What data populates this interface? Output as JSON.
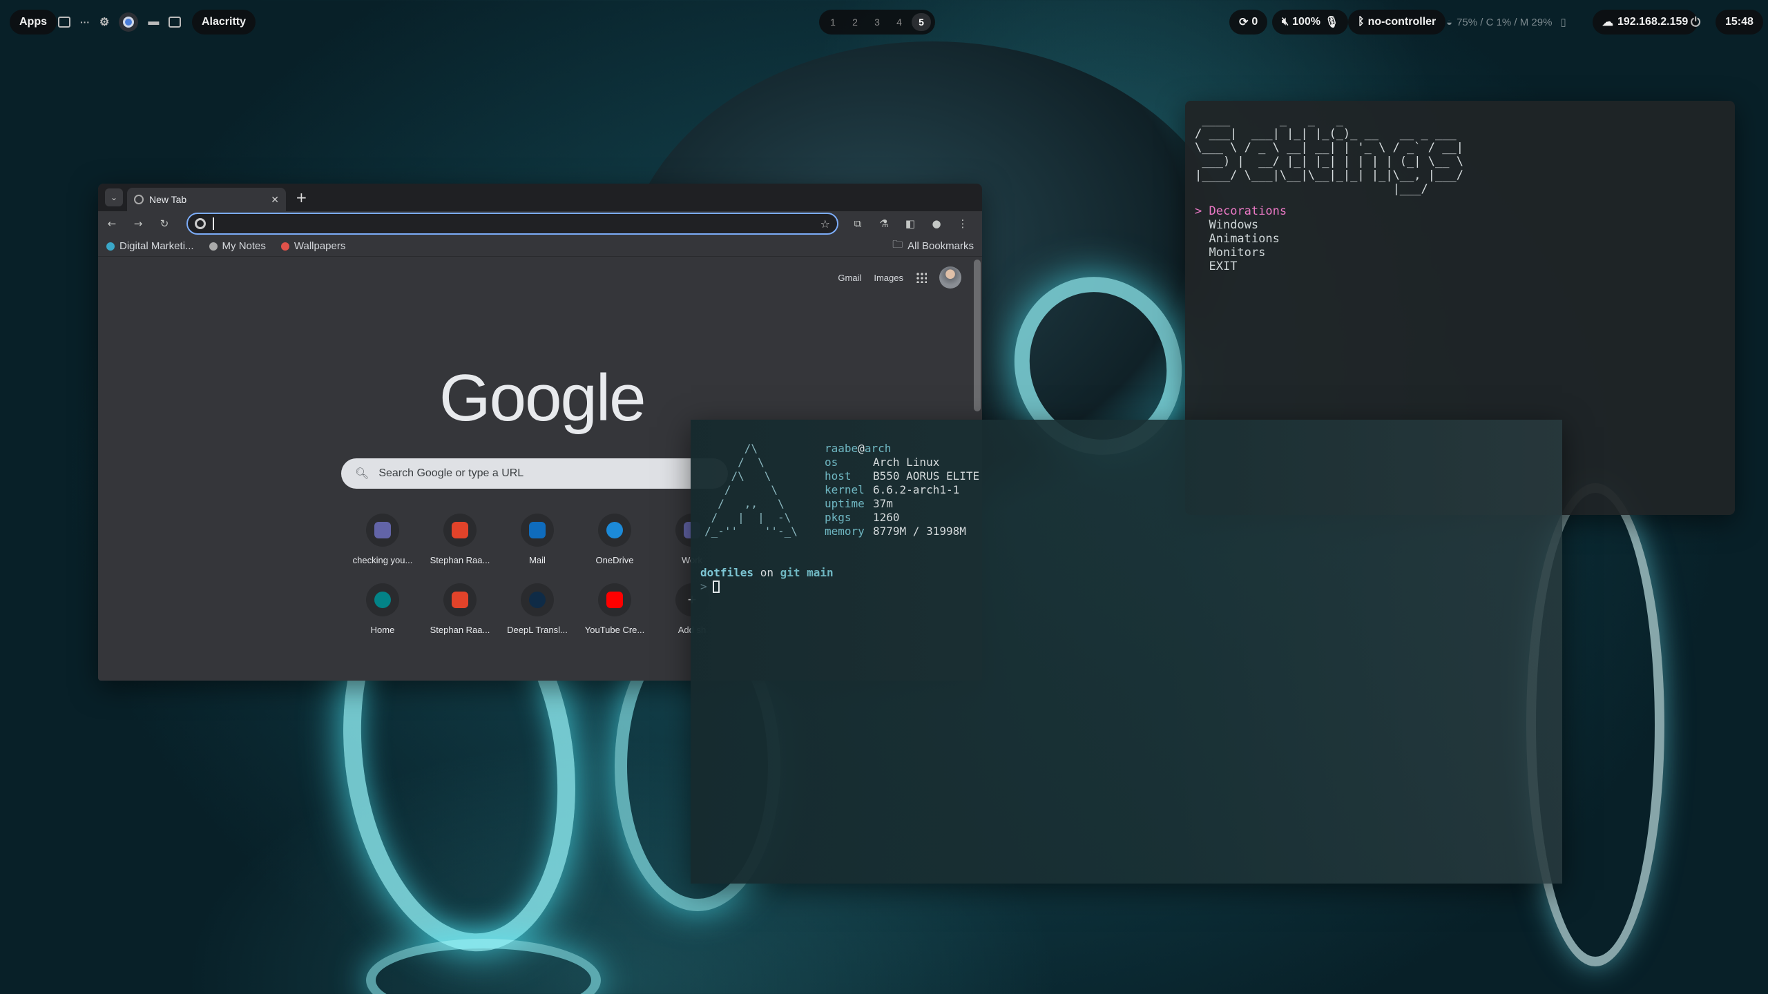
{
  "topbar": {
    "apps_label": "Apps",
    "active_app": "Alacritty",
    "workspaces": [
      "1",
      "2",
      "3",
      "4",
      "5"
    ],
    "active_workspace": "5",
    "updates": "0",
    "volume": "100%",
    "bluetooth": "no-controller",
    "stats": "75% / C 1% / M 29%",
    "ip": "192.168.2.159",
    "clock": "15:48"
  },
  "chrome": {
    "tab_title": "New Tab",
    "omnibox_value": "",
    "bookmarks": [
      "Digital Marketi...",
      "My Notes",
      "Wallpapers"
    ],
    "all_bookmarks": "All Bookmarks",
    "ntp_links": [
      "Gmail",
      "Images"
    ],
    "google_logo": "Google",
    "search_placeholder": "Search Google or type a URL",
    "shortcuts_row1": [
      "checking you...",
      "Stephan Raa...",
      "Mail",
      "OneDrive",
      "Work"
    ],
    "shortcuts_row2": [
      "Home",
      "Stephan Raa...",
      "DeepL Transl...",
      "YouTube Cre...",
      "Add sh"
    ],
    "icon_colors": {
      "teams": "#6264a7",
      "gitlab": "#e2432a",
      "outlook": "#0f6cbd",
      "onedrive": "#1c8ad8",
      "sharepoint": "#038387",
      "deepl": "#0f2b46",
      "youtube": "#ff0000"
    }
  },
  "settings": {
    "ascii": " ____       _   _   _                 \n/ ___|  ___| |_| |_(_)_ __   __ _ ___ \n\\___ \\ / _ \\ __| __| | '_ \\ / _` / __|\n ___) |  __/ |_| |_| | | | | (_| \\__ \\\n|____/ \\___|\\__|\\__|_|_| |_|\\__, |___/\n                            |___/     ",
    "selector": ">",
    "menu": [
      "Decorations",
      "Windows",
      "Animations",
      "Monitors",
      "EXIT"
    ]
  },
  "fetch": {
    "user": "raabe",
    "at": "@",
    "host": "arch",
    "logo": "      /\\\n     /  \\\n    /\\   \\\n   /      \\\n  /   ,,   \\\n /   |  |  -\\\n/_-''    ''-_\\",
    "rows": [
      {
        "key": "os",
        "value": "Arch Linux"
      },
      {
        "key": "host",
        "value": "B550 AORUS ELITE"
      },
      {
        "key": "kernel",
        "value": "6.6.2-arch1-1"
      },
      {
        "key": "uptime",
        "value": "37m"
      },
      {
        "key": "pkgs",
        "value": "1260"
      },
      {
        "key": "memory",
        "value": "8779M / 31998M"
      }
    ],
    "prompt_dir": "dotfiles",
    "prompt_on": "on",
    "prompt_branch": "git main",
    "prompt_symbol": ">"
  }
}
